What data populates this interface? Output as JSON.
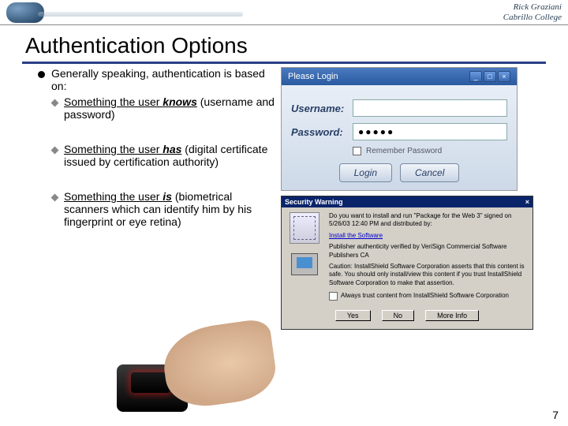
{
  "header": {
    "author": "Rick Graziani",
    "org": "Cabrillo College"
  },
  "title": "Authentication Options",
  "bullets": {
    "intro": "Generally speaking, authentication is based on:",
    "b1_u": "Something the user ",
    "b1_em": "knows",
    "b1_rest": " (username and password)",
    "b2_u": "Something the user ",
    "b2_em": "has",
    "b2_rest": " (digital certificate issued by certification authority)",
    "b3_u": "Something the user ",
    "b3_em": "is",
    "b3_rest": " (biometrical scanners which can identify him by his fingerprint or eye retina)"
  },
  "login": {
    "title": "Please Login",
    "user_label": "Username:",
    "pass_label": "Password:",
    "pass_value": "●●●●●",
    "remember": "Remember Password",
    "btn_login": "Login",
    "btn_cancel": "Cancel"
  },
  "secwarn": {
    "title": "Security Warning",
    "line1": "Do you want to install and run \"Package for the Web 3\" signed on 5/26/03 12:40 PM and distributed by:",
    "link1": "Install the Software",
    "line2": "Publisher authenticity verified by VeriSign Commercial Software Publishers CA",
    "line3": "Caution: InstallShield Software Corporation asserts that this content is safe. You should only install/view this content if you trust InstallShield Software Corporation to make that assertion.",
    "always": "Always trust content from InstallShield Software Corporation",
    "btn_yes": "Yes",
    "btn_no": "No",
    "btn_more": "More Info"
  },
  "page": "7"
}
